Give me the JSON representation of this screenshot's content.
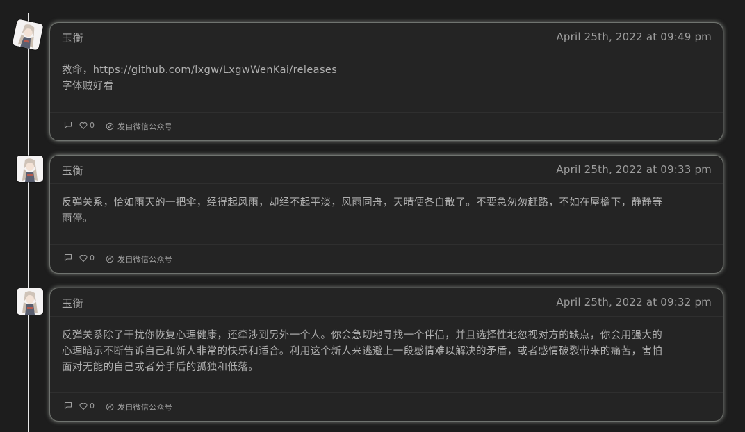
{
  "posts": [
    {
      "author": "玉衡",
      "date": "April 25th, 2022 at 09:49 pm",
      "lines": [
        "救命，https://github.com/lxgw/LxgwWenKai/releases",
        "字体贼好看"
      ],
      "likes": "0",
      "source": "发自微信公众号"
    },
    {
      "author": "玉衡",
      "date": "April 25th, 2022 at 09:33 pm",
      "lines": [
        "反弹关系，恰如雨天的一把伞，经得起风雨，却经不起平淡，风雨同舟，天晴便各自散了。不要急匆匆赶路，不如在屋檐下，静静等",
        "雨停。"
      ],
      "likes": "0",
      "source": "发自微信公众号"
    },
    {
      "author": "玉衡",
      "date": "April 25th, 2022 at 09:32 pm",
      "lines": [
        "反弹关系除了干扰你恢复心理健康，还牵涉到另外一个人。你会急切地寻找一个伴侣，并且选择性地忽视对方的缺点，你会用强大的",
        "心理暗示不断告诉自己和新人非常的快乐和适合。利用这个新人来逃避上一段感情难以解决的矛盾，或者感情破裂带来的痛苦，害怕",
        "面对无能的自己或者分手后的孤独和低落。"
      ],
      "likes": "0",
      "source": "发自微信公众号"
    }
  ],
  "icons": {
    "comment": "comment-icon",
    "like": "heart-icon",
    "source": "compass-icon"
  },
  "colors": {
    "background": "#1d1d1d",
    "card": "#242424",
    "glow": "#aaafa8",
    "timeline": "#e8e8e8"
  }
}
